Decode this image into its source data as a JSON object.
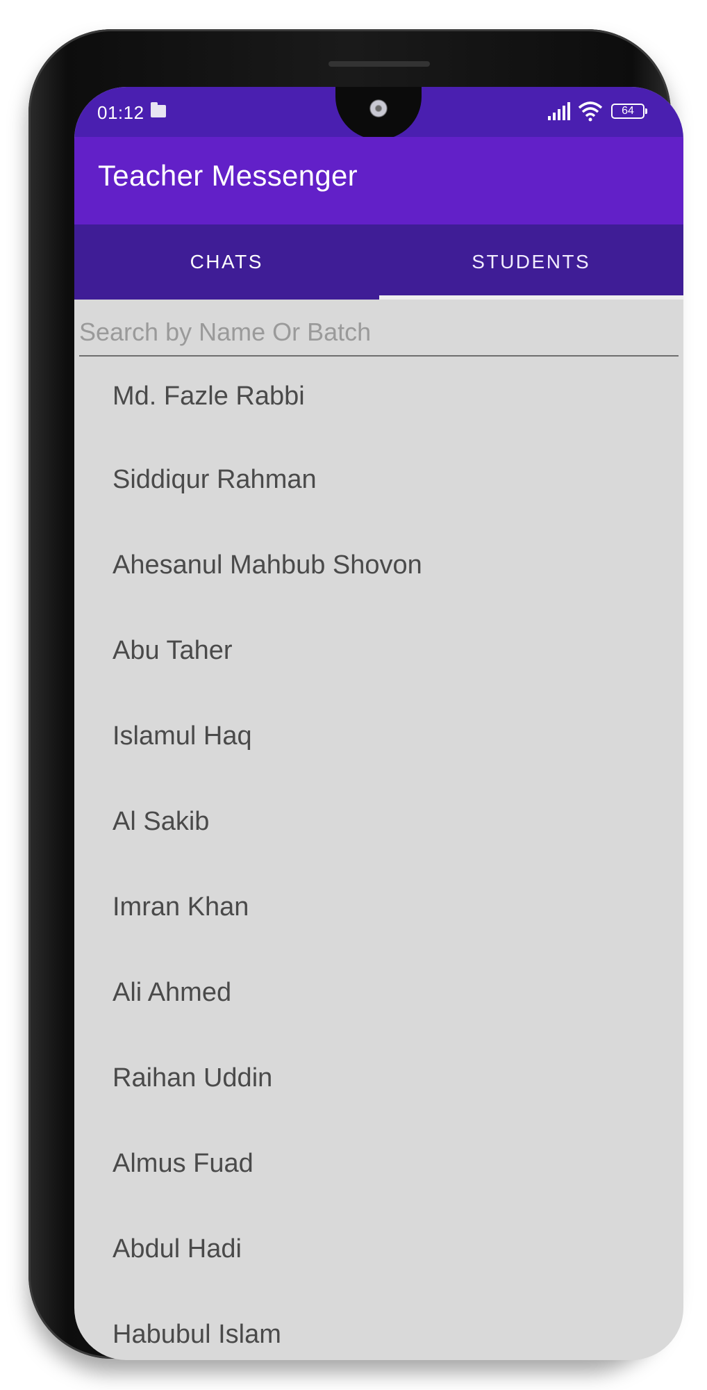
{
  "status_bar": {
    "time": "01:12",
    "battery": "64",
    "icons": [
      "folder-icon",
      "signal-icon",
      "wifi-icon",
      "battery-icon"
    ]
  },
  "app_bar": {
    "title": "Teacher Messenger",
    "color": "#6220C8"
  },
  "tabs": [
    {
      "label": "CHATS",
      "active": false
    },
    {
      "label": "STUDENTS",
      "active": true
    }
  ],
  "tabs_color": "#3F1D96",
  "search": {
    "placeholder": "Search by Name Or Batch",
    "value": ""
  },
  "students": [
    "Md. Fazle Rabbi",
    "Siddiqur Rahman",
    "Ahesanul Mahbub Shovon",
    "Abu Taher",
    "Islamul Haq",
    "Al Sakib",
    "Imran Khan",
    "Ali Ahmed",
    "Raihan Uddin",
    "Almus Fuad",
    "Abdul Hadi",
    "Habubul Islam"
  ]
}
